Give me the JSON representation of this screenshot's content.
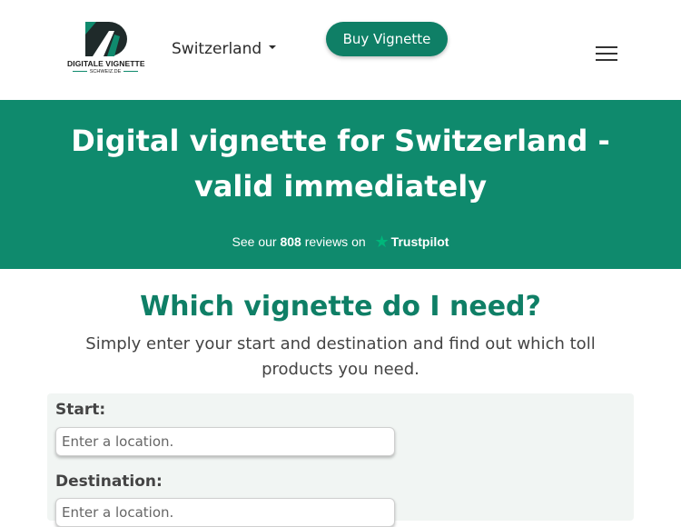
{
  "header": {
    "logo": {
      "title": "DIGITALE VIGNETTE",
      "subtitle": "SCHWEIZ.DE"
    },
    "country": "Switzerland",
    "buy_button": "Buy Vignette"
  },
  "hero": {
    "title": "Digital vignette for Switzerland - valid immediately",
    "trustpilot": {
      "prefix": "See our",
      "count": "808",
      "suffix": "reviews on",
      "brand": "Trustpilot"
    }
  },
  "main": {
    "title": "Which vignette do I need?",
    "description": "Simply enter your start and destination and find out which toll products you need.",
    "start": {
      "label": "Start:",
      "placeholder": "Enter a location."
    },
    "destination": {
      "label": "Destination:",
      "placeholder": "Enter a location."
    }
  },
  "colors": {
    "brand_green": "#0f8a6d",
    "button_green": "#0f7f66",
    "trustpilot_star": "#00b67a"
  }
}
